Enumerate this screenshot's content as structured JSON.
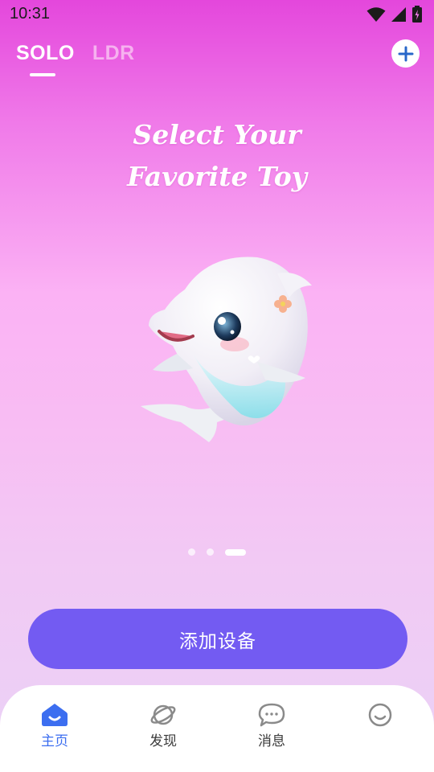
{
  "status_bar": {
    "time": "10:31"
  },
  "top_tabs": [
    {
      "label": "SOLO",
      "active": true
    },
    {
      "label": "LDR",
      "active": false
    }
  ],
  "add_button_icon": "plus-icon",
  "headline": {
    "line1": "Select Your",
    "line2": "Favorite Toy"
  },
  "carousel": {
    "page_count": 3,
    "active_index": 2,
    "image": "dolphin-toy-illustration"
  },
  "primary_button": {
    "label": "添加设备"
  },
  "bottom_nav": [
    {
      "label": "主页",
      "icon": "home-icon",
      "active": true
    },
    {
      "label": "发现",
      "icon": "planet-icon",
      "active": false
    },
    {
      "label": "消息",
      "icon": "chat-bubble-icon",
      "active": false
    },
    {
      "label": "",
      "icon": "smiley-face-icon",
      "active": false
    }
  ],
  "colors": {
    "accent": "#735bf2",
    "nav_active": "#3c6ef0",
    "gradient_top": "#e447dc"
  }
}
